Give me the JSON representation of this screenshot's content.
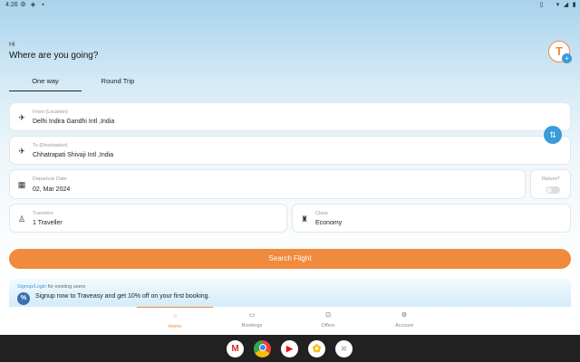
{
  "status_bar": {
    "time": "4:26"
  },
  "header": {
    "greeting": "Hi",
    "question": "Where are you going?",
    "avatar_initial": "T",
    "avatar_badge": "+"
  },
  "tabs": [
    {
      "label": "One way"
    },
    {
      "label": "Round Trip"
    }
  ],
  "from": {
    "label": "From (Location)",
    "value": "Delhi Indira Gandhi Intl ,India"
  },
  "to": {
    "label": "To (Destination)",
    "value": "Chhatrapati Shivaji Intl ,India"
  },
  "departure": {
    "label": "Departure Date",
    "value": "02, Mar 2024"
  },
  "return": {
    "label": "Return?"
  },
  "travelers": {
    "label": "Travelers",
    "value": "1 Traveller"
  },
  "class": {
    "label": "Class",
    "value": "Economy"
  },
  "search_button": "Search Flight",
  "promo": {
    "link": "Signup/Login",
    "link_suffix": " for existing users",
    "badge": "%",
    "text": "Signup now to Traveasy and get 10% off on your first booking."
  },
  "bottom_nav": [
    {
      "label": "Home",
      "icon": "home-icon"
    },
    {
      "label": "Bookings",
      "icon": "ticket-icon"
    },
    {
      "label": "Offers",
      "icon": "gift-icon"
    },
    {
      "label": "Account",
      "icon": "gear-icon"
    }
  ],
  "taskbar_apps": [
    "gmail",
    "chrome",
    "youtube",
    "photos",
    "app-drawer"
  ],
  "colors": {
    "accent": "#f08a3c",
    "blue": "#3a9bd8"
  }
}
